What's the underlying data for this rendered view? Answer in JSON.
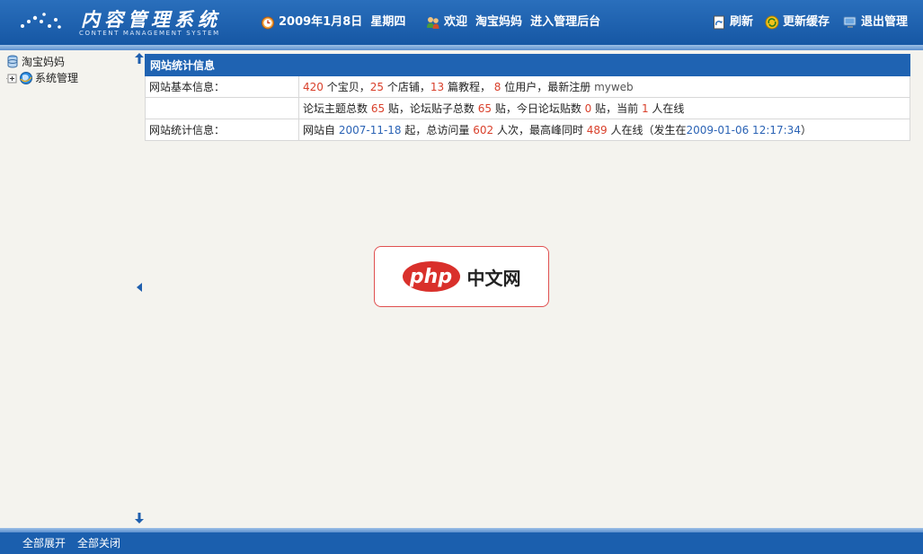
{
  "header": {
    "logo_title": "内容管理系统",
    "logo_subtitle": "CONTENT MANAGEMENT SYSTEM",
    "date_text": "2009年1月8日  星期四",
    "welcome_text": "欢迎  淘宝妈妈  进入管理后台",
    "refresh_label": "刷新",
    "update_cache_label": "更新缓存",
    "logout_label": "退出管理"
  },
  "sidebar": {
    "root_label": "淘宝妈妈",
    "items": [
      {
        "label": "系统管理"
      }
    ]
  },
  "stats": {
    "title": "网站统计信息",
    "row1": {
      "label": "网站基本信息：",
      "items_count": "420",
      "items_unit": " 个宝贝，",
      "shops_count": "25",
      "shops_unit": " 个店铺，",
      "tutorials_count": "13",
      "tutorials_unit": " 篇教程，",
      "users_count": "8",
      "users_unit": " 位用户，最新注册 ",
      "latest_user": "myweb"
    },
    "row2": {
      "label": "",
      "forum_topics_prefix": "论坛主题总数 ",
      "forum_topics": "65",
      "forum_posts_prefix": " 贴，论坛贴子总数 ",
      "forum_posts": "65",
      "today_posts_prefix": " 贴，今日论坛贴数 ",
      "today_posts": "0",
      "online_prefix": " 贴，当前 ",
      "online_now": "1",
      "online_suffix": " 人在线"
    },
    "row3": {
      "label": "网站统计信息：",
      "since_prefix": "网站自 ",
      "since_date": "2007-11-18",
      "visits_prefix": " 起，总访问量 ",
      "visits": "602",
      "peak_prefix": " 人次，最高峰同时 ",
      "peak_online": "489",
      "peak_suffix": " 人在线（发生在",
      "peak_time": "2009-01-06 12:17:34",
      "close_paren": "）"
    }
  },
  "watermark": {
    "logo_text": "php",
    "site_text": "中文网"
  },
  "footer": {
    "expand_all": "全部展开",
    "collapse_all": "全部关闭"
  },
  "colors": {
    "header_bg": "#1f63b2",
    "highlight_red": "#d9402b",
    "highlight_blue": "#2b63b5"
  },
  "icons": [
    "clock-icon",
    "users-icon",
    "refresh-icon",
    "update-cache-icon",
    "logout-icon",
    "database-icon",
    "tree-expand-icon",
    "globe-icon",
    "arrow-up-icon",
    "arrow-left-icon",
    "arrow-down-icon"
  ]
}
